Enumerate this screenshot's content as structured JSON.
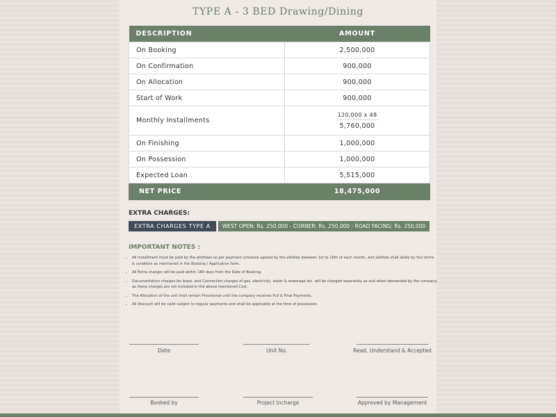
{
  "title": "TYPE A - 3 BED Drawing/Dining",
  "table": {
    "headers": [
      "DESCRIPTION",
      "AMOUNT"
    ],
    "rows": [
      {
        "description": "On Booking",
        "amount": "2,500,000"
      },
      {
        "description": "On Confirmation",
        "amount": "900,000"
      },
      {
        "description": "On Allocation",
        "amount": "900,000"
      },
      {
        "description": "Start of Work",
        "amount": "900,000"
      },
      {
        "description": "Monthly Installments",
        "calc": "120,000 x 48",
        "amount": "5,760,000"
      },
      {
        "description": "On Finishing",
        "amount": "1,000,000"
      },
      {
        "description": "On Possession",
        "amount": "1,000,000"
      },
      {
        "description": "Expected Loan",
        "amount": "5,515,000"
      }
    ],
    "net": {
      "label": "NET PRICE",
      "amount": "18,475,000"
    }
  },
  "extra_charges": {
    "heading": "EXTRA CHARGES:",
    "type_label": "EXTRA CHARGES TYPE A",
    "details": "WEST OPEN: Rs. 250,000 - CORNER: Rs. 250,000 - ROAD FACING: Rs. 250,000"
  },
  "notes": {
    "heading": "IMPORTANT NOTES :",
    "items": [
      "All Installment must be paid by the allottees as per payment schedule agreed by the allottee between 1st to 10th of each month, and allottee shall abide by the terms & condition as mentioned in the Booking / Application form.",
      "All Extra charges will be paid within 180 days from the Date of Booking.",
      "Documentation charges for lease, and Connection charges of gas, electricity, water & sewerage etc. will be charged separately as and when demanded by the company as these charges are not included in the above mentioned Cost.",
      "The Allocation of the unit shall remain Provisional until the company receives Full & Final Payments.",
      "All discount will be valid subject to regular payments and shall be applicable at the time of possession."
    ]
  },
  "signatures": {
    "row1": [
      "Date",
      "Unit No.",
      "Read, Understand & Accepted"
    ],
    "row2": [
      "Booked by",
      "Project Incharge",
      "Approved by Management"
    ]
  },
  "colors": {
    "accent": "#6b8068",
    "dark_label": "#3f4a56",
    "background": "#ece5df"
  }
}
